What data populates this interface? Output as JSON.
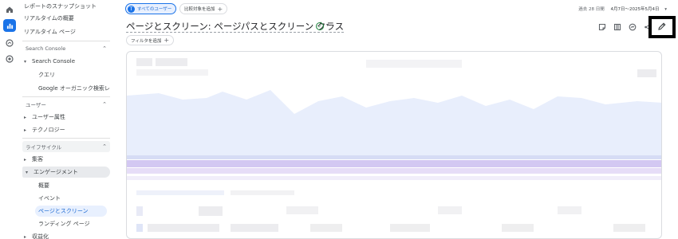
{
  "rail": {
    "icons": [
      "home-icon",
      "reports-icon",
      "explore-icon",
      "advertising-icon"
    ]
  },
  "sidebar": {
    "snapshot": "レポートのスナップショット",
    "realtime_overview": "リアルタイムの概要",
    "realtime_pages": "リアルタイム ページ",
    "sc_section": "Search Console",
    "sc_group": "Search Console",
    "sc_query": "クエリ",
    "sc_organic": "Google オーガニック検索レ...",
    "user_section": "ユーザー",
    "user_attr": "ユーザー属性",
    "technology": "テクノロジー",
    "lifecycle_section": "ライフサイクル",
    "acquisition": "集客",
    "engagement": "エンゲージメント",
    "overview": "概要",
    "events": "イベント",
    "pages_screens": "ページとスクリーン",
    "landing": "ランディング ページ",
    "monetization": "収益化"
  },
  "topbar": {
    "segment_badge": "T",
    "segment": "すべてのユーザー",
    "compare": "比較対象を追加",
    "range_label": "過去 28 日間",
    "range_value": "4月7日～2025年5月4日"
  },
  "title": {
    "text": "ページとスクリーン: ページパスとスクリーン クラス"
  },
  "filter": {
    "label": "フィルタを追加"
  },
  "colors": {
    "accent": "#1a73e8",
    "chart_fill": "#e8f0fe",
    "chart_line_purple": "#c5b8f0",
    "status_green": "#188038"
  }
}
